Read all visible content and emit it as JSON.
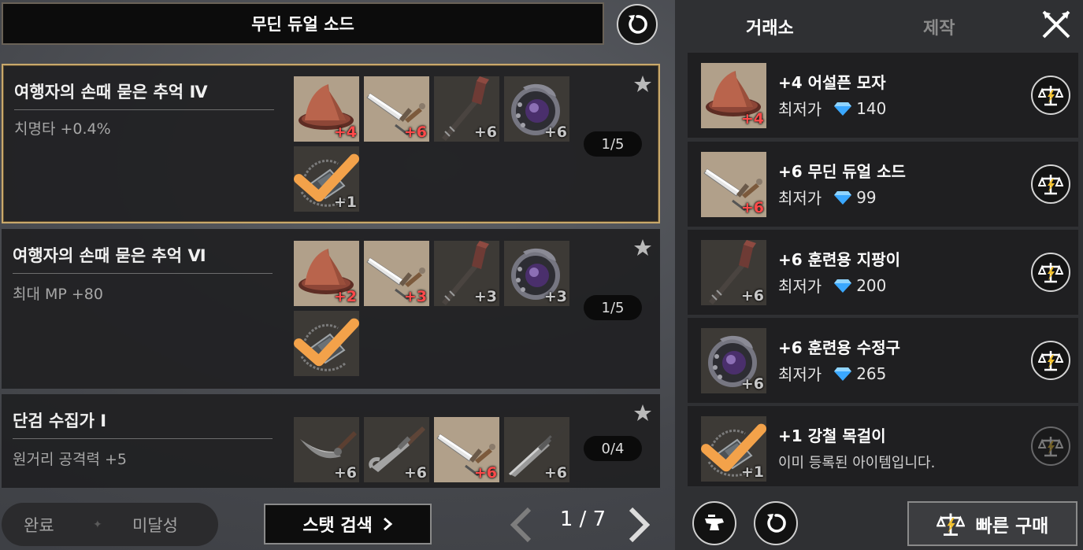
{
  "header": {
    "title": "무딘 듀얼 소드"
  },
  "collections": [
    {
      "name": "여행자의 손때 묻은 추억 Ⅳ",
      "stat": "치명타 +0.4%",
      "progress": "1/5",
      "items": [
        {
          "icon": "hat-icon",
          "level": "+4",
          "upgraded": true
        },
        {
          "icon": "dual-sword-icon",
          "level": "+6",
          "upgraded": true
        },
        {
          "icon": "training-staff-icon",
          "level": "+6",
          "upgraded": false
        },
        {
          "icon": "crystal-orb-icon",
          "level": "+6",
          "upgraded": false
        },
        {
          "icon": "steel-necklace-icon",
          "level": "+1",
          "registered": true
        }
      ]
    },
    {
      "name": "여행자의 손때 묻은 추억 Ⅵ",
      "stat": "최대 MP +80",
      "progress": "1/5",
      "items": [
        {
          "icon": "hat-icon",
          "level": "+2",
          "upgraded": true
        },
        {
          "icon": "dual-sword-icon",
          "level": "+3",
          "upgraded": true
        },
        {
          "icon": "training-staff-icon",
          "level": "+3",
          "upgraded": false
        },
        {
          "icon": "crystal-orb-icon",
          "level": "+3",
          "upgraded": false
        },
        {
          "icon": "steel-necklace-icon",
          "level": "",
          "registered": true
        }
      ]
    },
    {
      "name": "단검 수집가 Ⅰ",
      "stat": "원거리 공격력 +5",
      "progress": "0/4",
      "items": [
        {
          "icon": "curved-dagger-icon",
          "level": "+6",
          "upgraded": false
        },
        {
          "icon": "hook-dagger-icon",
          "level": "+6",
          "upgraded": false
        },
        {
          "icon": "dual-sword-icon",
          "level": "+6",
          "upgraded": true
        },
        {
          "icon": "straight-dagger-icon",
          "level": "+6",
          "upgraded": false
        }
      ]
    }
  ],
  "filters": {
    "complete": "완료",
    "incomplete": "미달성"
  },
  "stat_search_label": "스탯 검색",
  "pagination": {
    "text": "1 / 7"
  },
  "tabs": {
    "market": "거래소",
    "craft": "제작"
  },
  "market": {
    "price_label": "최저가",
    "items": [
      {
        "name": "+4 어설픈 모자",
        "price": "140",
        "icon": "hat-icon",
        "level": "+4"
      },
      {
        "name": "+6 무딘 듀얼 소드",
        "price": "99",
        "icon": "dual-sword-icon",
        "level": "+6"
      },
      {
        "name": "+6 훈련용 지팡이",
        "price": "200",
        "icon": "training-staff-icon",
        "level": "+6"
      },
      {
        "name": "+6 훈련용 수정구",
        "price": "265",
        "icon": "crystal-orb-icon",
        "level": "+6"
      },
      {
        "name": "+1 강철 목걸이",
        "note": "이미 등록된 아이템입니다.",
        "icon": "steel-necklace-icon",
        "level": "+1"
      }
    ]
  },
  "quick_buy_label": "빠른 구매",
  "colors": {
    "gold_border": "#c9a96c",
    "upgrade_red": "#ff4a4a",
    "gem_blue": "#3aa8ff",
    "check_orange": "#f3a24a"
  }
}
